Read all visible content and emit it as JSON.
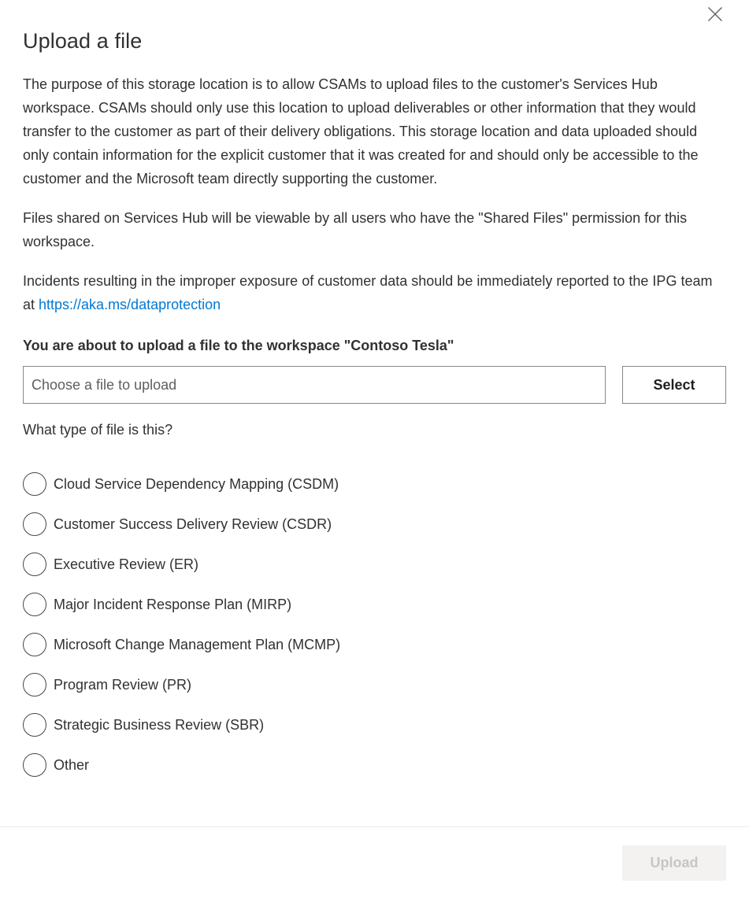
{
  "dialog": {
    "title": "Upload a file",
    "close_icon": "close-icon",
    "paragraphs": [
      "The purpose of this storage location is to allow CSAMs to upload files to the customer's Services Hub workspace. CSAMs should only use this location to upload deliverables or other information that they would transfer to the customer as part of their delivery obligations. This storage location and data uploaded should only contain information for the explicit customer that it was created for and should only be accessible to the customer and the Microsoft team directly supporting the customer.",
      "Files shared on Services Hub will be viewable by all users who have the \"Shared Files\" permission for this workspace."
    ],
    "incident_paragraph": {
      "prefix": "Incidents resulting in the improper exposure of customer data should be immediately reported to the IPG team at ",
      "link_text": "https://aka.ms/dataprotection",
      "link_color": "#0078d4"
    },
    "workspace_line": "You are about to upload a file to the workspace \"Contoso Tesla\"",
    "file_picker": {
      "placeholder": "Choose a file to upload",
      "value": "",
      "select_label": "Select"
    },
    "file_type_question": "What type of file is this?",
    "file_type_options": [
      {
        "label": "Cloud Service Dependency Mapping (CSDM)",
        "selected": false
      },
      {
        "label": "Customer Success Delivery Review (CSDR)",
        "selected": false
      },
      {
        "label": "Executive Review (ER)",
        "selected": false
      },
      {
        "label": "Major Incident Response Plan (MIRP)",
        "selected": false
      },
      {
        "label": "Microsoft Change Management Plan (MCMP)",
        "selected": false
      },
      {
        "label": "Program Review (PR)",
        "selected": false
      },
      {
        "label": "Strategic Business Review (SBR)",
        "selected": false
      },
      {
        "label": "Other",
        "selected": false
      }
    ],
    "footer": {
      "upload_label": "Upload",
      "upload_disabled": true
    }
  }
}
